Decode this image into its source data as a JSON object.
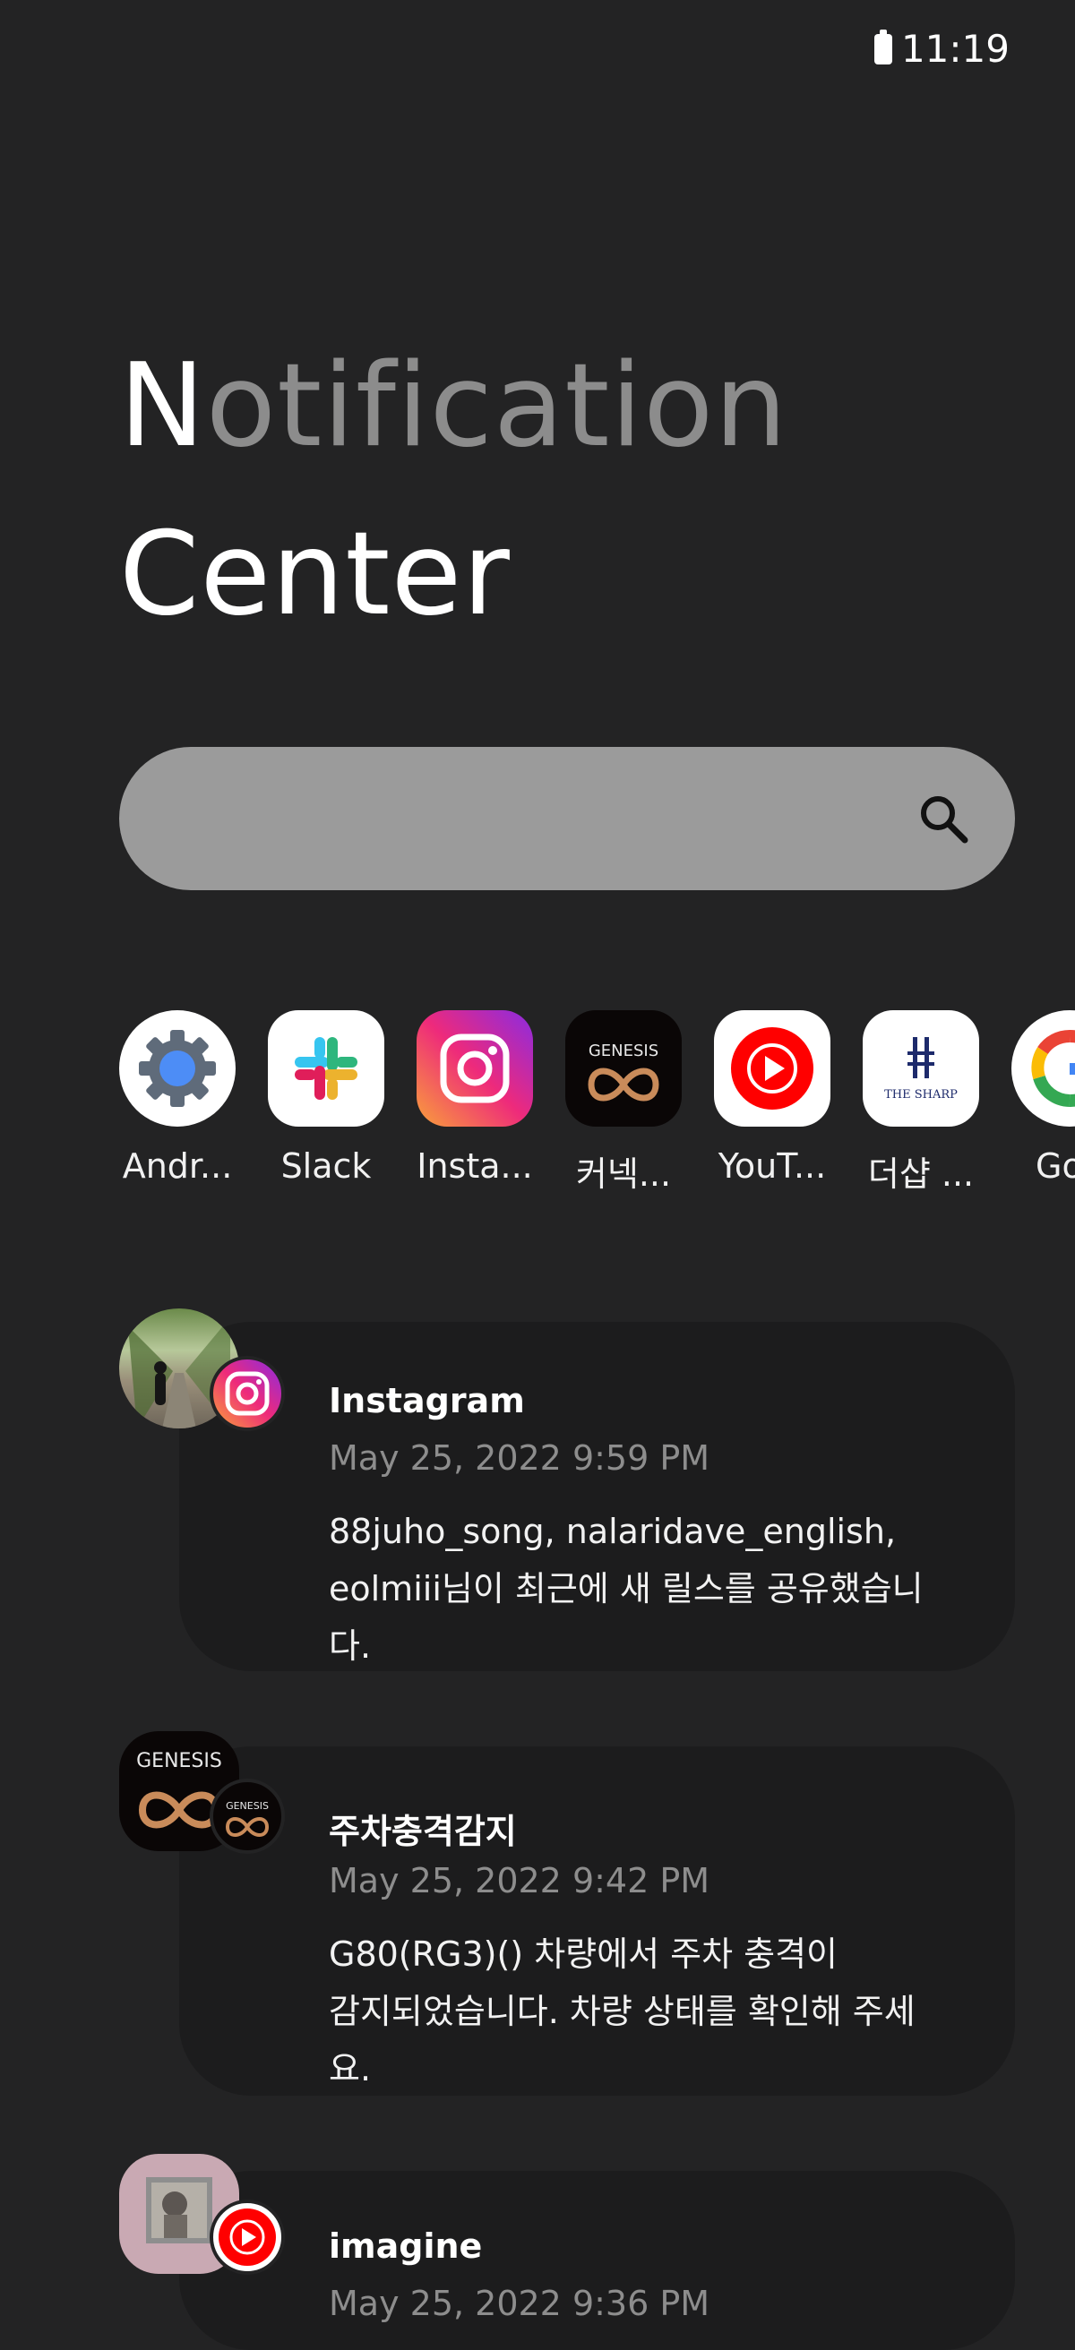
{
  "status": {
    "time": "11:19"
  },
  "header": {
    "title_first": "N",
    "title_rest": "otification",
    "title_line2": "Center"
  },
  "search": {
    "placeholder": ""
  },
  "apps": [
    {
      "label": "Andr...",
      "icon": "android-settings-icon"
    },
    {
      "label": "Slack",
      "icon": "slack-icon"
    },
    {
      "label": "Insta...",
      "icon": "instagram-icon"
    },
    {
      "label": "커넥...",
      "icon": "genesis-connect-icon"
    },
    {
      "label": "YouT...",
      "icon": "youtube-music-icon"
    },
    {
      "label": "더샵 ...",
      "icon": "the-sharp-icon"
    },
    {
      "label": "Goo",
      "icon": "google-icon"
    }
  ],
  "notifications": [
    {
      "app": "Instagram",
      "time": "May 25, 2022 9:59 PM",
      "body_line1": "88juho_song, nalaridave_english,",
      "body_line2": "eolmiii님이 최근에 새 릴스를 공유했습니다."
    },
    {
      "app": "주차충격감지",
      "time": "May 25, 2022 9:42 PM",
      "body_line1": "G80(RG3)() 차량에서 주차 충격이",
      "body_line2": "감지되었습니다. 차량 상태를 확인해 주세요."
    },
    {
      "app": "imagine",
      "time": "May 25, 2022 9:36 PM"
    }
  ],
  "colors": {
    "background": "#232324",
    "card": "#1c1c1d",
    "search": "#9b9b9b",
    "muted_text": "#8d8d8d"
  }
}
